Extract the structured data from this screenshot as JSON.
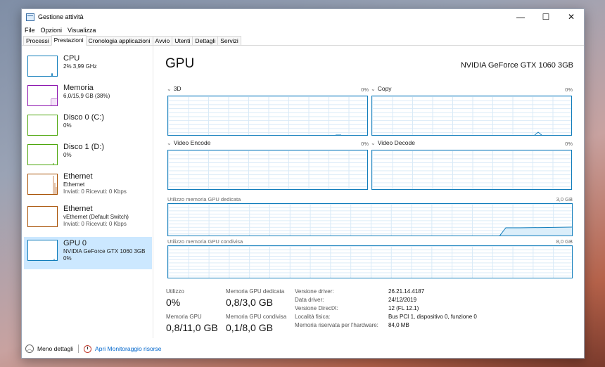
{
  "window": {
    "title": "Gestione attività",
    "controls": {
      "minimize": "—",
      "maximize": "☐",
      "close": "✕"
    }
  },
  "menu": [
    "File",
    "Opzioni",
    "Visualizza"
  ],
  "tabs": [
    {
      "label": "Processi",
      "active": false
    },
    {
      "label": "Prestazioni",
      "active": true
    },
    {
      "label": "Cronologia applicazioni",
      "active": false
    },
    {
      "label": "Avvio",
      "active": false
    },
    {
      "label": "Utenti",
      "active": false
    },
    {
      "label": "Dettagli",
      "active": false
    },
    {
      "label": "Servizi",
      "active": false
    }
  ],
  "sidebar": {
    "items": [
      {
        "title": "CPU",
        "sub": "2% 3,99 GHz",
        "sub2": "",
        "color": "#117dbb"
      },
      {
        "title": "Memoria",
        "sub": "6,0/15,9 GB (38%)",
        "sub2": "",
        "color": "#8b12ae"
      },
      {
        "title": "Disco 0 (C:)",
        "sub": "0%",
        "sub2": "",
        "color": "#4da60c"
      },
      {
        "title": "Disco 1 (D:)",
        "sub": "0%",
        "sub2": "",
        "color": "#4da60c"
      },
      {
        "title": "Ethernet",
        "sub": "Ethernet",
        "sub2": "Inviati: 0 Ricevuti: 0 Kbps",
        "color": "#a74f01"
      },
      {
        "title": "Ethernet",
        "sub": "vEthernet (Default Switch)",
        "sub2": "Inviati: 0 Ricevuti: 0 Kbps",
        "color": "#a74f01"
      },
      {
        "title": "GPU 0",
        "sub": "NVIDIA GeForce GTX 1060 3GB",
        "sub2": "0%",
        "color": "#117dbb"
      }
    ]
  },
  "main": {
    "title": "GPU",
    "model": "NVIDIA GeForce GTX 1060 3GB",
    "graphs": [
      {
        "label": "3D",
        "pct": "0%"
      },
      {
        "label": "Copy",
        "pct": "0%"
      },
      {
        "label": "Video Encode",
        "pct": "0%"
      },
      {
        "label": "Video Decode",
        "pct": "0%"
      }
    ],
    "dedicated": {
      "label": "Utilizzo memoria GPU dedicata",
      "max": "3,0 GB"
    },
    "shared": {
      "label": "Utilizzo memoria GPU condivisa",
      "max": "8,0 GB"
    },
    "stats": {
      "utilization_label": "Utilizzo",
      "utilization_value": "0%",
      "dedicated_label": "Memoria GPU dedicata",
      "dedicated_value": "0,8/3,0 GB",
      "gpu_mem_label": "Memoria GPU",
      "gpu_mem_value": "0,8/11,0 GB",
      "shared_label": "Memoria GPU condivisa",
      "shared_value": "0,1/8,0 GB"
    },
    "info": [
      {
        "key": "Versione driver:",
        "value": "26.21.14.4187"
      },
      {
        "key": "Data driver:",
        "value": "24/12/2019"
      },
      {
        "key": "Versione DirectX:",
        "value": "12 (FL 12.1)"
      },
      {
        "key": "Località fisica:",
        "value": "Bus PCI 1, dispositivo 0, funzione 0"
      },
      {
        "key": "Memoria riservata per l'hardware:",
        "value": "84,0 MB"
      }
    ]
  },
  "footer": {
    "less_details": "Meno dettagli",
    "open_monitor": "Apri Monitoraggio risorse"
  }
}
